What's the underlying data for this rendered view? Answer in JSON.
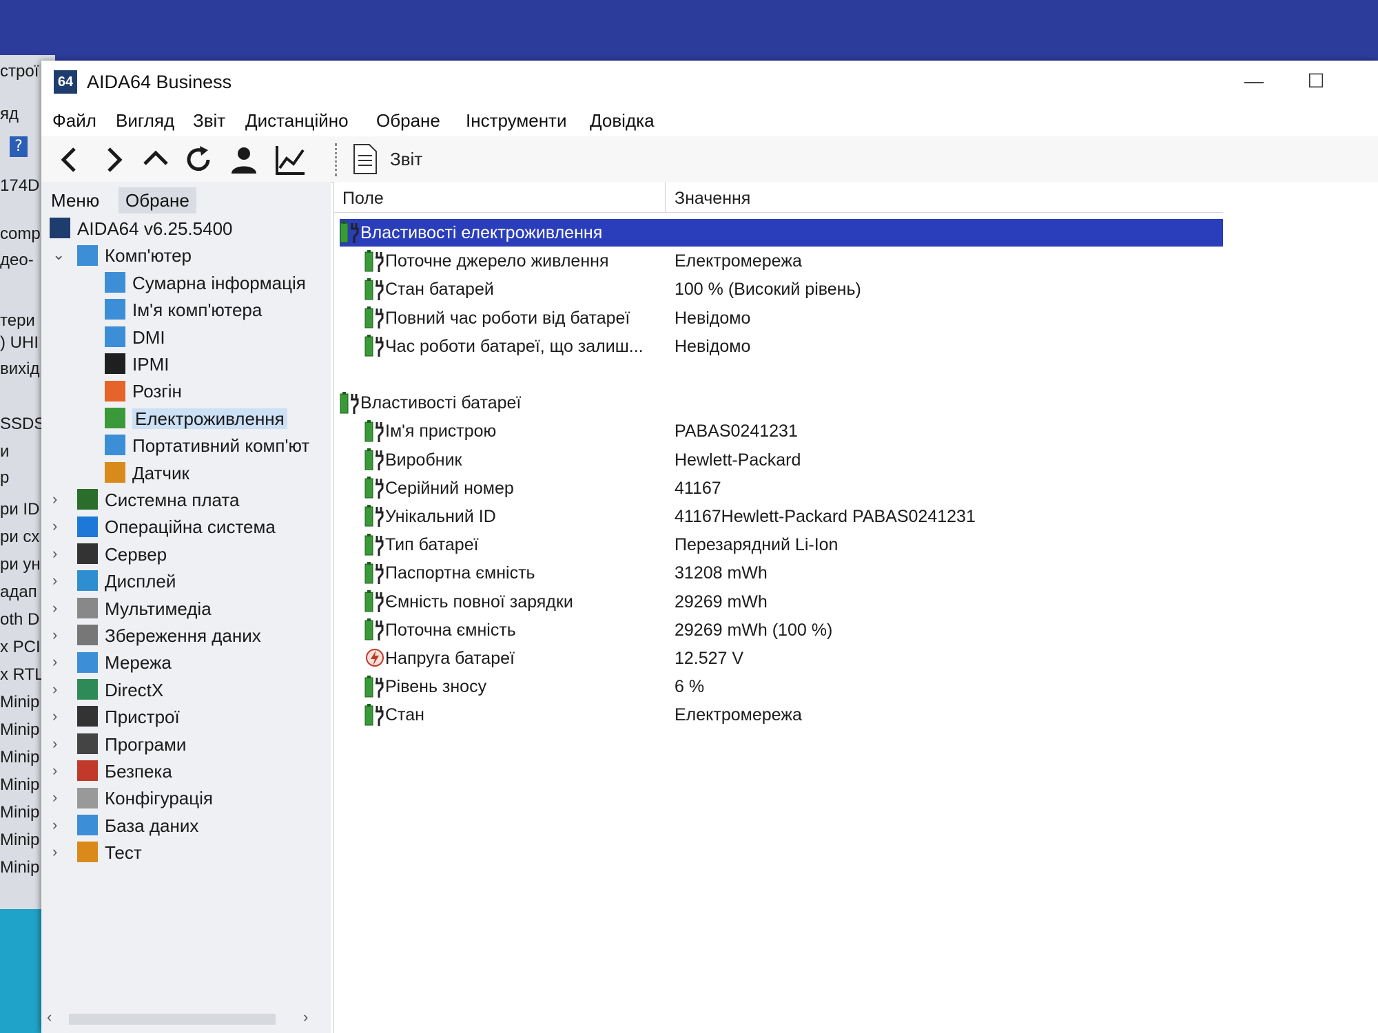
{
  "background_window": {
    "lines": [
      "строї",
      "яд",
      "174D",
      "comp",
      "део-",
      "тери",
      ") UHI",
      "вихід",
      "SSDS",
      "и",
      "р",
      "ри ID",
      "ри сх",
      "ри ун",
      "адап",
      "oth D",
      "x PCI",
      "x RTL",
      "Minip",
      "Minip",
      "Minip",
      "Minip",
      "Minip",
      "Minip",
      "Minip"
    ]
  },
  "window": {
    "title": "AIDA64 Business",
    "icon_text": "64",
    "minimize": "—",
    "maximize": "☐"
  },
  "menubar": [
    "Файл",
    "Вигляд",
    "Звіт",
    "Дистанційно",
    "Обране",
    "Інструменти",
    "Довідка"
  ],
  "toolbar": {
    "buttons": [
      "back-icon",
      "forward-icon",
      "up-icon",
      "refresh-icon",
      "user-icon",
      "chart-icon"
    ],
    "report_label": "Звіт"
  },
  "left_tabs": [
    "Меню",
    "Обране"
  ],
  "tree": {
    "root": "AIDA64 v6.25.5400",
    "computer": "Комп'ютер",
    "computer_children": [
      "Сумарна інформація",
      "Ім'я комп'ютера",
      "DMI",
      "IPMI",
      "Розгін",
      "Електроживлення",
      "Портативний комп'ют",
      "Датчик"
    ],
    "groups": [
      "Системна плата",
      "Операційна система",
      "Сервер",
      "Дисплей",
      "Мультимедіа",
      "Збереження даних",
      "Мережа",
      "DirectX",
      "Пристрої",
      "Програми",
      "Безпека",
      "Конфігурація",
      "База даних",
      "Тест"
    ],
    "selected": "Електроживлення"
  },
  "columns": {
    "field": "Поле",
    "value": "Значення"
  },
  "sections": [
    {
      "title": "Властивості електроживлення",
      "rows": [
        {
          "field": "Поточне джерело живлення",
          "value": "Електромережа"
        },
        {
          "field": "Стан батарей",
          "value": "100 % (Високий рівень)"
        },
        {
          "field": "Повний час роботи від батареї",
          "value": "Невідомо"
        },
        {
          "field": "Час роботи батареї, що залиш...",
          "value": "Невідомо"
        }
      ]
    },
    {
      "title": "Властивості батареї",
      "rows": [
        {
          "field": "Ім'я пристрою",
          "value": "PABAS0241231"
        },
        {
          "field": "Виробник",
          "value": "Hewlett-Packard"
        },
        {
          "field": "Серійний номер",
          "value": "41167"
        },
        {
          "field": "Унікальний ID",
          "value": "41167Hewlett-Packard PABAS0241231"
        },
        {
          "field": "Тип батареї",
          "value": "Перезарядний Li-Ion"
        },
        {
          "field": "Паспортна ємність",
          "value": "31208 mWh"
        },
        {
          "field": "Ємність повної зарядки",
          "value": "29269 mWh"
        },
        {
          "field": "Поточна ємність",
          "value": "29269 mWh  (100 %)"
        },
        {
          "field": "Напруга батареї",
          "value": "12.527 V"
        },
        {
          "field": "Рівень зносу",
          "value": "6 %"
        },
        {
          "field": "Стан",
          "value": "Електромережа"
        }
      ]
    }
  ],
  "colors": {
    "selection": "#2a3dba",
    "desktop": "#2c3c9a"
  }
}
